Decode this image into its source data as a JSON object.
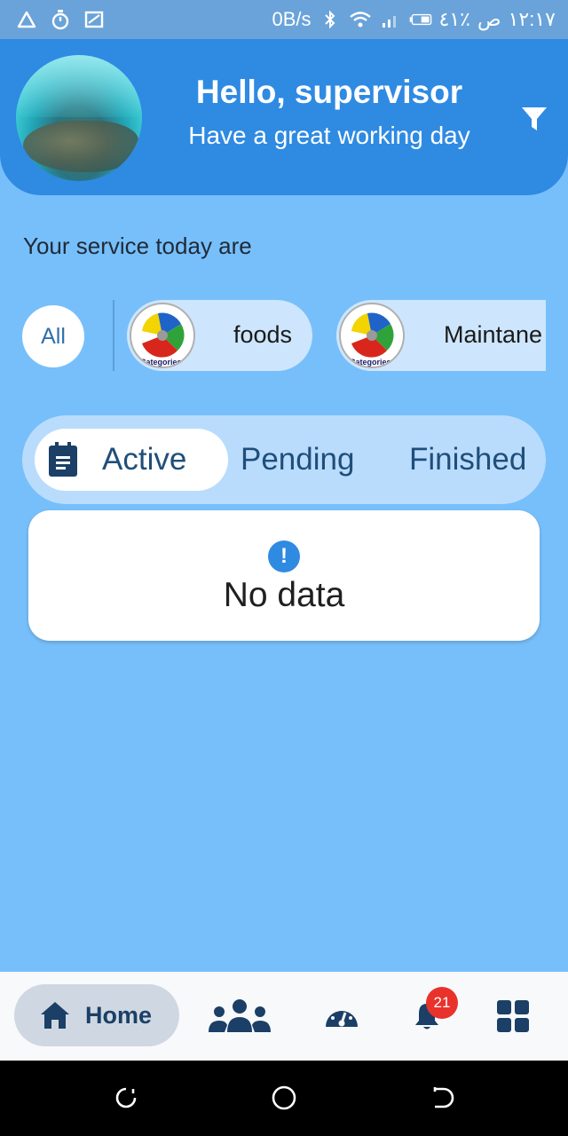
{
  "status_bar": {
    "network_speed": "0B/s",
    "battery_percent": "٤١٪",
    "am_pm": "ص",
    "time": "١٢:١٧"
  },
  "header": {
    "title": "Hello, supervisor",
    "subtitle": "Have a great working day"
  },
  "services": {
    "title": "Your service today are",
    "all_label": "All",
    "categories": [
      {
        "label": "foods",
        "thumb_caption": "Categories"
      },
      {
        "label": "Maintane",
        "thumb_caption": "Categories"
      }
    ]
  },
  "tabs": {
    "items": [
      "Active",
      "Pending",
      "Finished"
    ],
    "selected": "Active"
  },
  "empty_state": {
    "icon": "!",
    "message": "No data"
  },
  "bottom_nav": {
    "home_label": "Home",
    "notification_count": "21",
    "items": [
      "home-icon",
      "team-icon",
      "dashboard-gauge-icon",
      "bell-icon",
      "grid-menu-icon"
    ]
  },
  "colors": {
    "background": "#77bffb",
    "header": "#2f8ae2",
    "chip": "#cde6fd",
    "tab_track": "#b9dcfd",
    "nav_active": "#cfd8e2",
    "icon_dark": "#1b3f66",
    "badge": "#e8322b"
  }
}
